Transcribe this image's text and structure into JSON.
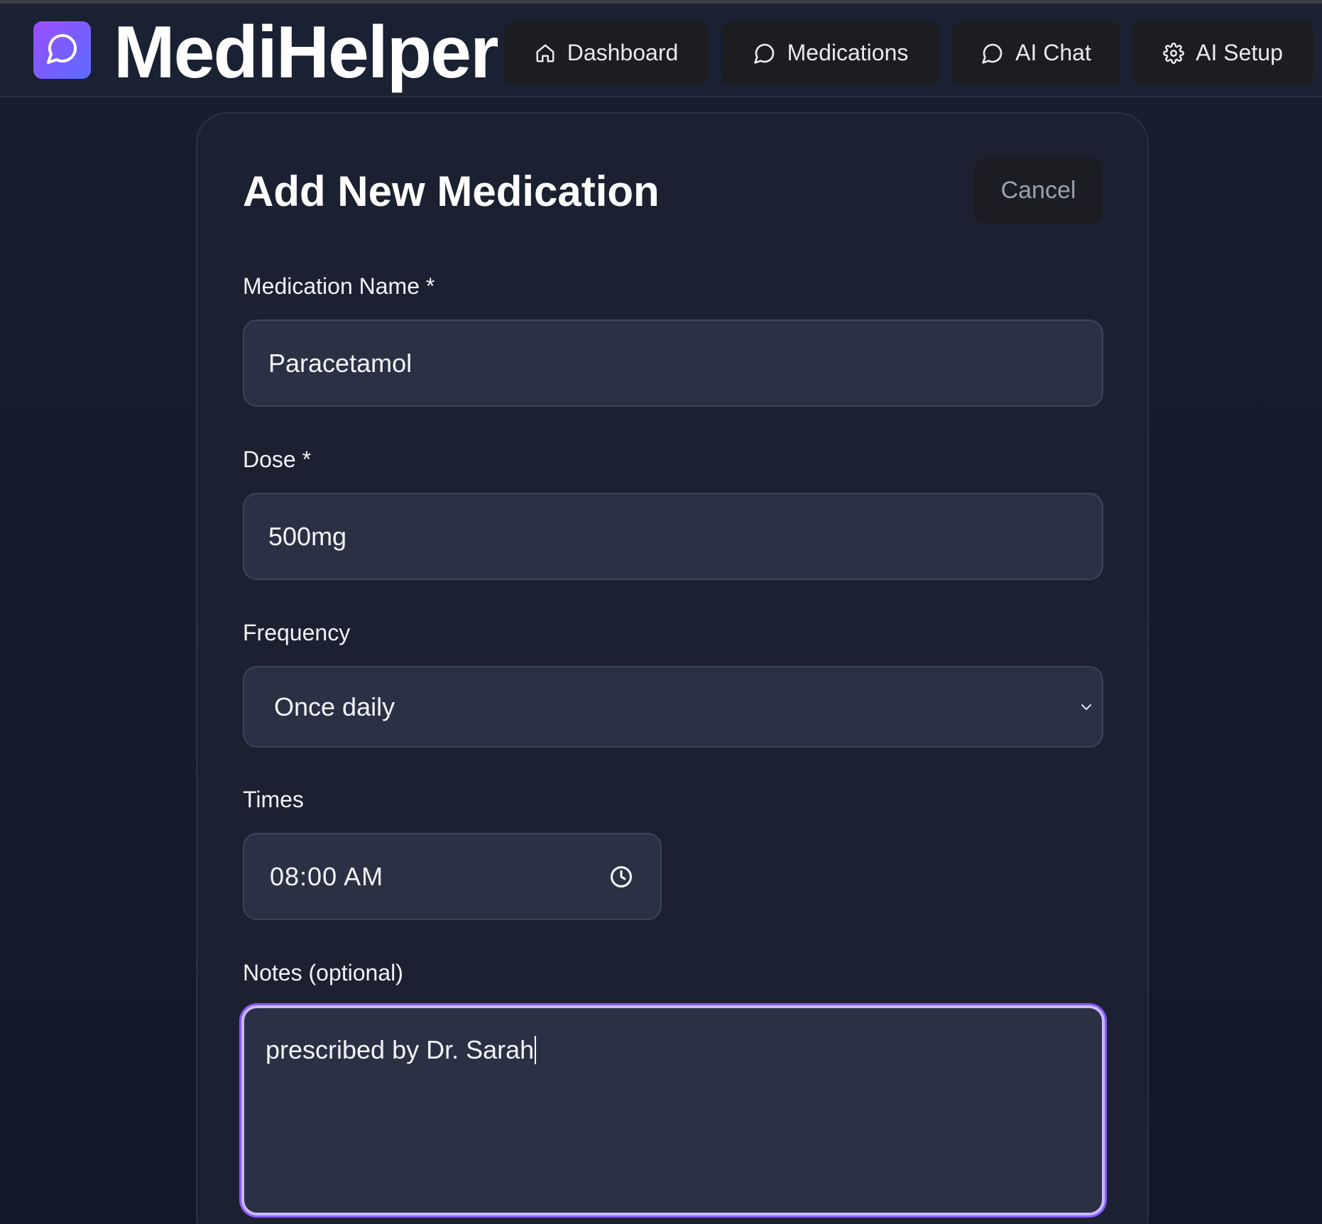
{
  "app": {
    "title": "MediHelper",
    "logo_icon": "chat-bubble-icon",
    "brand_gradient": [
      "#9b4dff",
      "#5b6dff"
    ]
  },
  "nav": {
    "items": [
      {
        "label": "Dashboard",
        "icon": "home-icon"
      },
      {
        "label": "Medications",
        "icon": "chat-bubble-icon"
      },
      {
        "label": "AI Chat",
        "icon": "chat-bubble-icon"
      },
      {
        "label": "AI Setup",
        "icon": "gear-icon"
      }
    ]
  },
  "form": {
    "title": "Add New Medication",
    "cancel_label": "Cancel",
    "fields": {
      "name": {
        "label": "Medication Name *",
        "value": "Paracetamol"
      },
      "dose": {
        "label": "Dose *",
        "value": "500mg"
      },
      "frequency": {
        "label": "Frequency",
        "selected": "Once daily"
      },
      "times": {
        "label": "Times",
        "value": "08:00 AM"
      },
      "notes": {
        "label": "Notes (optional)",
        "value": "prescribed by Dr. Sarah"
      }
    },
    "focus_color": "#8b5cf6"
  }
}
